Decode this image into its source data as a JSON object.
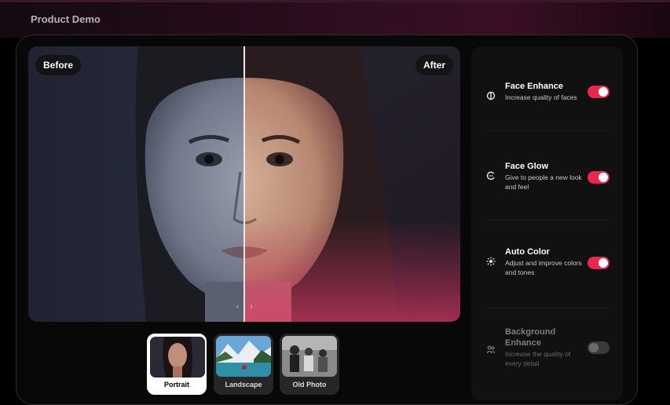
{
  "header": {
    "title": "Product Demo"
  },
  "viewer": {
    "before_label": "Before",
    "after_label": "After",
    "handle": "‹ ›"
  },
  "thumbnails": [
    {
      "label": "Portrait",
      "active": true
    },
    {
      "label": "Landscape",
      "active": false
    },
    {
      "label": "Old Photo",
      "active": false
    }
  ],
  "features": [
    {
      "title": "Face Enhance",
      "description": "Increase quality of faces",
      "icon": "shield-icon",
      "enabled": true
    },
    {
      "title": "Face Glow",
      "description": "Give to people a new look and feel",
      "icon": "glow-icon",
      "enabled": true
    },
    {
      "title": "Auto Color",
      "description": "Adjust and improve colors and tones",
      "icon": "sun-icon",
      "enabled": true
    },
    {
      "title": "Background Enhance",
      "description": "Increase the quality of every detail",
      "icon": "people-icon",
      "enabled": false
    }
  ],
  "colors": {
    "accent": "#e8284f",
    "panel": "#111111"
  }
}
